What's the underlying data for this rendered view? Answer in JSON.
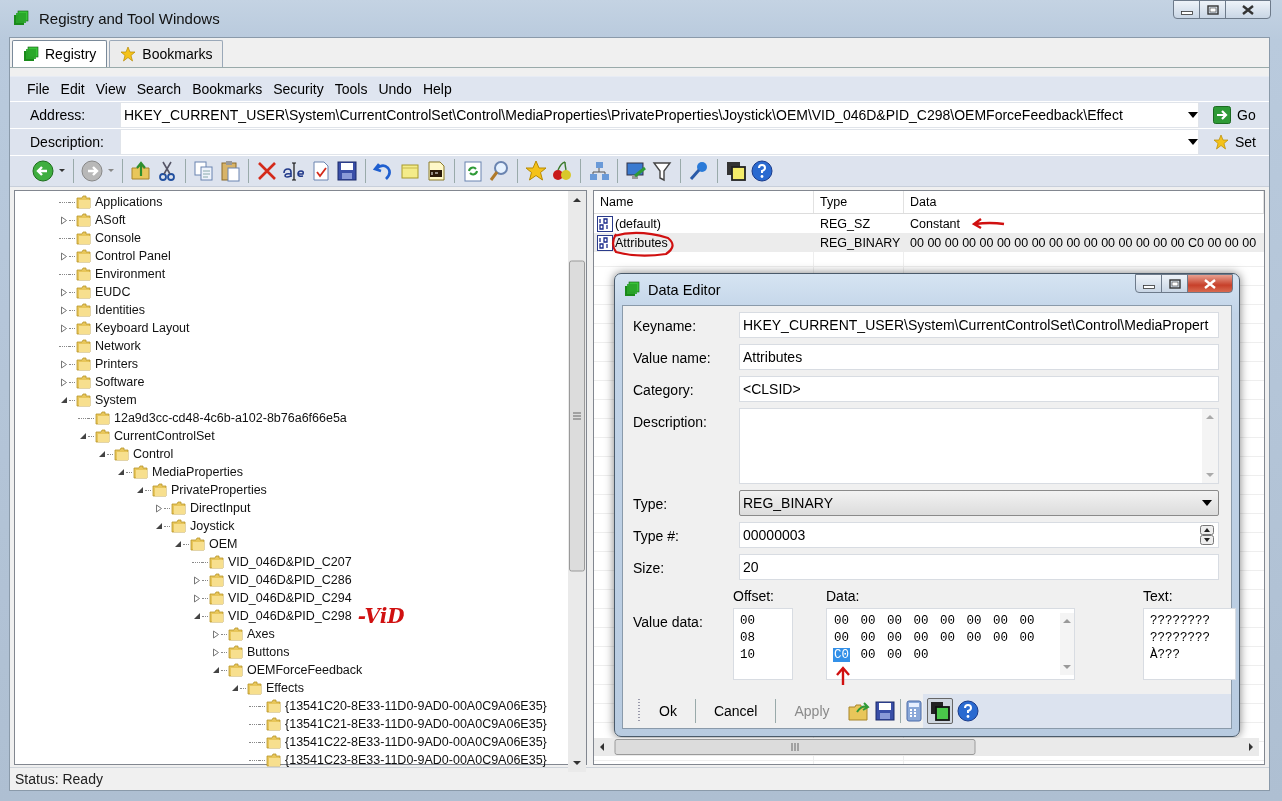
{
  "window": {
    "title": "Registry and Tool Windows"
  },
  "tabs": [
    {
      "label": "Registry",
      "selected": true
    },
    {
      "label": "Bookmarks",
      "selected": false
    }
  ],
  "menu": [
    "File",
    "Edit",
    "View",
    "Search",
    "Bookmarks",
    "Security",
    "Tools",
    "Undo",
    "Help"
  ],
  "address_bar": {
    "label": "Address:",
    "value": "HKEY_CURRENT_USER\\System\\CurrentControlSet\\Control\\MediaProperties\\PrivateProperties\\Joystick\\OEM\\VID_046D&PID_C298\\OEMForceFeedback\\Effect",
    "button": "Go"
  },
  "description_bar": {
    "label": "Description:",
    "button": "Set"
  },
  "tree": [
    {
      "label": "Applications",
      "kind": "leaf"
    },
    {
      "label": "ASoft",
      "kind": "branch",
      "expanded": false
    },
    {
      "label": "Console",
      "kind": "leaf"
    },
    {
      "label": "Control Panel",
      "kind": "branch",
      "expanded": false
    },
    {
      "label": "Environment",
      "kind": "leaf"
    },
    {
      "label": "EUDC",
      "kind": "branch",
      "expanded": false
    },
    {
      "label": "Identities",
      "kind": "branch",
      "expanded": false
    },
    {
      "label": "Keyboard Layout",
      "kind": "branch",
      "expanded": false
    },
    {
      "label": "Network",
      "kind": "leaf"
    },
    {
      "label": "Printers",
      "kind": "branch",
      "expanded": false
    },
    {
      "label": "Software",
      "kind": "branch",
      "expanded": false
    },
    {
      "label": "System",
      "kind": "branch",
      "expanded": true,
      "children": [
        {
          "label": "12a9d3cc-cd48-4c6b-a102-8b76a6f66e5a",
          "kind": "leaf"
        },
        {
          "label": "CurrentControlSet",
          "kind": "branch",
          "expanded": true,
          "children": [
            {
              "label": "Control",
              "kind": "branch",
              "expanded": true,
              "children": [
                {
                  "label": "MediaProperties",
                  "kind": "branch",
                  "expanded": true,
                  "children": [
                    {
                      "label": "PrivateProperties",
                      "kind": "branch",
                      "expanded": true,
                      "children": [
                        {
                          "label": "DirectInput",
                          "kind": "branch",
                          "expanded": false
                        },
                        {
                          "label": "Joystick",
                          "kind": "branch",
                          "expanded": true,
                          "children": [
                            {
                              "label": "OEM",
                              "kind": "branch",
                              "expanded": true,
                              "children": [
                                {
                                  "label": "VID_046D&PID_C207",
                                  "kind": "leaf"
                                },
                                {
                                  "label": "VID_046D&PID_C286",
                                  "kind": "branch",
                                  "expanded": false
                                },
                                {
                                  "label": "VID_046D&PID_C294",
                                  "kind": "branch",
                                  "expanded": false
                                },
                                {
                                  "label": "VID_046D&PID_C298",
                                  "kind": "branch",
                                  "expanded": true,
                                  "annotation": "-ViD",
                                  "children": [
                                    {
                                      "label": "Axes",
                                      "kind": "branch",
                                      "expanded": false
                                    },
                                    {
                                      "label": "Buttons",
                                      "kind": "branch",
                                      "expanded": false
                                    },
                                    {
                                      "label": "OEMForceFeedback",
                                      "kind": "branch",
                                      "expanded": true,
                                      "children": [
                                        {
                                          "label": "Effects",
                                          "kind": "branch",
                                          "expanded": true,
                                          "children": [
                                            {
                                              "label": "{13541C20-8E33-11D0-9AD0-00A0C9A06E35}",
                                              "kind": "leaf"
                                            },
                                            {
                                              "label": "{13541C21-8E33-11D0-9AD0-00A0C9A06E35}",
                                              "kind": "leaf"
                                            },
                                            {
                                              "label": "{13541C22-8E33-11D0-9AD0-00A0C9A06E35}",
                                              "kind": "leaf"
                                            },
                                            {
                                              "label": "{13541C23-8E33-11D0-9AD0-00A0C9A06E35}",
                                              "kind": "leaf"
                                            }
                                          ]
                                        }
                                      ]
                                    }
                                  ]
                                }
                              ]
                            }
                          ]
                        }
                      ]
                    }
                  ]
                }
              ]
            }
          ]
        }
      ]
    }
  ],
  "values_list": {
    "columns": [
      "Name",
      "Type",
      "Data"
    ],
    "rows": [
      {
        "name": "(default)",
        "type": "REG_SZ",
        "data": "Constant",
        "selected": false,
        "circled": false,
        "arrowed": true
      },
      {
        "name": "Attributes",
        "type": "REG_BINARY",
        "data": "00 00 00 00 00 00 00 00 00 00 00 00 00 00 00 00 C0 00 00 00",
        "selected": true,
        "circled": true,
        "arrowed": false
      }
    ]
  },
  "data_editor": {
    "title": "Data Editor",
    "fields": [
      {
        "label": "Keyname:",
        "value": "HKEY_CURRENT_USER\\System\\CurrentControlSet\\Control\\MediaPropert",
        "kind": "text"
      },
      {
        "label": "Value name:",
        "value": "Attributes",
        "kind": "text"
      },
      {
        "label": "Category:",
        "value": "<CLSID>",
        "kind": "text"
      },
      {
        "label": "Description:",
        "kind": "memo"
      },
      {
        "label": "Type:",
        "value": "REG_BINARY",
        "kind": "dropdown"
      },
      {
        "label": "Type #:",
        "value": "00000003",
        "kind": "spinner"
      },
      {
        "label": "Size:",
        "value": "20",
        "kind": "text"
      }
    ],
    "value_data": {
      "label": "Value data:",
      "offset_label": "Offset:",
      "data_label": "Data:",
      "text_label": "Text:",
      "offsets": [
        "00",
        "08",
        "10"
      ],
      "rows": [
        [
          {
            "byte": "00",
            "selected": false
          },
          {
            "byte": "00",
            "selected": false
          },
          {
            "byte": "00",
            "selected": false
          },
          {
            "byte": "00",
            "selected": false
          },
          {
            "byte": "00",
            "selected": false
          },
          {
            "byte": "00",
            "selected": false
          },
          {
            "byte": "00",
            "selected": false
          },
          {
            "byte": "00",
            "selected": false
          }
        ],
        [
          {
            "byte": "00",
            "selected": false
          },
          {
            "byte": "00",
            "selected": false
          },
          {
            "byte": "00",
            "selected": false
          },
          {
            "byte": "00",
            "selected": false
          },
          {
            "byte": "00",
            "selected": false
          },
          {
            "byte": "00",
            "selected": false
          },
          {
            "byte": "00",
            "selected": false
          },
          {
            "byte": "00",
            "selected": false
          }
        ],
        [
          {
            "byte": "C0",
            "selected": true,
            "arrowed": true
          },
          {
            "byte": "00",
            "selected": false
          },
          {
            "byte": "00",
            "selected": false
          },
          {
            "byte": "00",
            "selected": false
          }
        ]
      ],
      "text_lines": [
        "????????",
        "????????",
        "À???"
      ]
    },
    "buttons": [
      {
        "label": "Ok",
        "disabled": false
      },
      {
        "label": "Cancel",
        "disabled": false
      },
      {
        "label": "Apply",
        "disabled": true
      }
    ]
  },
  "status_bar": "Status: Ready"
}
